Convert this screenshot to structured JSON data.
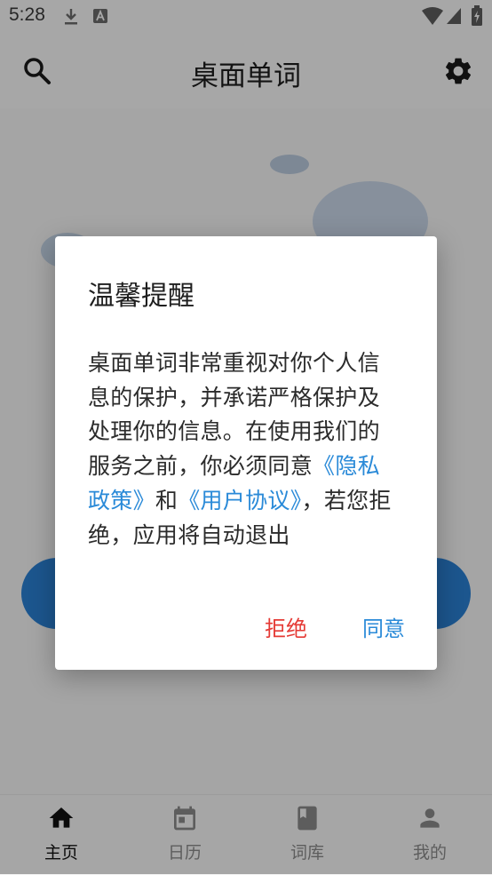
{
  "status_bar": {
    "time": "5:28"
  },
  "app_bar": {
    "title": "桌面单词"
  },
  "bottom_nav": {
    "items": [
      {
        "label": "主页",
        "icon": "home-icon",
        "active": true
      },
      {
        "label": "日历",
        "icon": "calendar-icon",
        "active": false
      },
      {
        "label": "词库",
        "icon": "book-icon",
        "active": false
      },
      {
        "label": "我的",
        "icon": "person-icon",
        "active": false
      }
    ]
  },
  "dialog": {
    "title": "温馨提醒",
    "body_intro": "桌面单词非常重视对你个人信息的保护，并承诺严格保护及处理你的信息。在使用我们的服务之前，你必须同意",
    "privacy_link": "《隐私政策》",
    "conjunction": "和",
    "agreement_link": "《用户协议》",
    "body_outro": "，若您拒绝，应用将自动退出",
    "reject_label": "拒绝",
    "agree_label": "同意"
  },
  "colors": {
    "accent_blue": "#2a8ad8",
    "reject_red": "#e53a35"
  }
}
